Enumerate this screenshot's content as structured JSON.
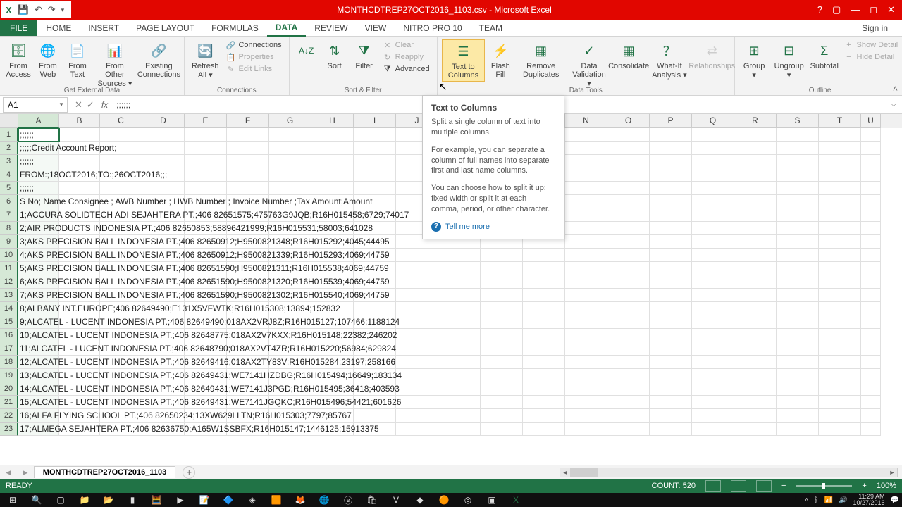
{
  "title": "MONTHCDTREP27OCT2016_1103.csv - Microsoft Excel",
  "tabs": [
    "FILE",
    "HOME",
    "INSERT",
    "PAGE LAYOUT",
    "FORMULAS",
    "DATA",
    "REVIEW",
    "VIEW",
    "NITRO PRO 10",
    "TEAM"
  ],
  "active_tab": "DATA",
  "signin": "Sign in",
  "ribbon": {
    "getdata": {
      "label": "Get External Data",
      "btns": [
        "From Access",
        "From Web",
        "From Text",
        "From Other Sources ▾",
        "Existing Connections"
      ]
    },
    "connections": {
      "label": "Connections",
      "refresh": "Refresh All ▾",
      "items": [
        "Connections",
        "Properties",
        "Edit Links"
      ]
    },
    "sortfilter": {
      "label": "Sort & Filter",
      "sort": "Sort",
      "filter": "Filter",
      "items": [
        "Clear",
        "Reapply",
        "Advanced"
      ]
    },
    "datatools": {
      "label": "Data Tools",
      "btns": [
        "Text to Columns",
        "Flash Fill",
        "Remove Duplicates",
        "Data Validation ▾",
        "Consolidate",
        "What-If Analysis ▾",
        "Relationships"
      ]
    },
    "outline": {
      "label": "Outline",
      "btns": [
        "Group ▾",
        "Ungroup ▾",
        "Subtotal"
      ],
      "items": [
        "Show Detail",
        "Hide Detail"
      ]
    }
  },
  "namebox": "A1",
  "formula": ";;;;;;",
  "tooltip": {
    "title": "Text to Columns",
    "p1": "Split a single column of text into multiple columns.",
    "p2": "For example, you can separate a column of full names into separate first and last name columns.",
    "p3": "You can choose how to split it up: fixed width or split it at each comma, period, or other character.",
    "more": "Tell me more"
  },
  "columns": [
    "A",
    "B",
    "C",
    "D",
    "E",
    "F",
    "G",
    "H",
    "I",
    "J",
    "K",
    "L",
    "M",
    "N",
    "O",
    "P",
    "Q",
    "R",
    "S",
    "T",
    "U"
  ],
  "rows": [
    {
      "n": 1,
      "t": ";;;;;;"
    },
    {
      "n": 2,
      "t": ";;;;;Credit Account Report;"
    },
    {
      "n": 3,
      "t": ";;;;;;"
    },
    {
      "n": 4,
      "t": "FROM:;18OCT2016;TO:;26OCT2016;;;"
    },
    {
      "n": 5,
      "t": ";;;;;;"
    },
    {
      "n": 6,
      "t": "S No;  Name Consignee    ;  AWB Number    ;   HWB Number       ;  Invoice Number  ;Tax Amount;Amount"
    },
    {
      "n": 7,
      "t": "1;ACCURA SOLIDTECH ADI SEJAHTERA PT.;406 82651575;475763G9JQB;R16H015458;6729;74017"
    },
    {
      "n": 8,
      "t": "2;AIR PRODUCTS INDONESIA PT.;406 82650853;58896421999;R16H015531;58003;641028"
    },
    {
      "n": 9,
      "t": "3;AKS PRECISION BALL INDONESIA PT.;406 82650912;H9500821348;R16H015292;4045;44495"
    },
    {
      "n": 10,
      "t": "4;AKS PRECISION BALL INDONESIA PT.;406 82650912;H9500821339;R16H015293;4069;44759"
    },
    {
      "n": 11,
      "t": "5;AKS PRECISION BALL INDONESIA PT.;406 82651590;H9500821311;R16H015538;4069;44759"
    },
    {
      "n": 12,
      "t": "6;AKS PRECISION BALL INDONESIA PT.;406 82651590;H9500821320;R16H015539;4069;44759"
    },
    {
      "n": 13,
      "t": "7;AKS PRECISION BALL INDONESIA PT.;406 82651590;H9500821302;R16H015540;4069;44759"
    },
    {
      "n": 14,
      "t": "8;ALBANY INT.EUROPE;406 82649490;E131X5VFWTK;R16H015308;13894;152832"
    },
    {
      "n": 15,
      "t": "9;ALCATEL - LUCENT INDONESIA PT.;406 82649490;018AX2VRJ8Z;R16H015127;107466;1188124"
    },
    {
      "n": 16,
      "t": "10;ALCATEL - LUCENT INDONESIA PT.;406 82648775;018AX2V7KXX;R16H015148;22382;246202"
    },
    {
      "n": 17,
      "t": "11;ALCATEL - LUCENT INDONESIA PT.;406 82648790;018AX2VT4ZR;R16H015220;56984;629824"
    },
    {
      "n": 18,
      "t": "12;ALCATEL - LUCENT INDONESIA PT.;406 82649416;018AX2TY83V;R16H015284;23197;258166"
    },
    {
      "n": 19,
      "t": "13;ALCATEL - LUCENT INDONESIA PT.;406 82649431;WE7141HZDBG;R16H015494;16649;183134"
    },
    {
      "n": 20,
      "t": "14;ALCATEL - LUCENT INDONESIA PT.;406 82649431;WE7141J3PGD;R16H015495;36418;403593"
    },
    {
      "n": 21,
      "t": "15;ALCATEL - LUCENT INDONESIA PT.;406 82649431;WE7141JGQKC;R16H015496;54421;601626"
    },
    {
      "n": 22,
      "t": "16;ALFA FLYING SCHOOL PT.;406 82650234;13XW629LLTN;R16H015303;7797;85767"
    },
    {
      "n": 23,
      "t": "17;ALMEGA SEJAHTERA PT.;406 82636750;A165W1SSBFX;R16H015147;1446125;15913375"
    }
  ],
  "sheet_name": "MONTHCDTREP27OCT2016_1103",
  "status": {
    "ready": "READY",
    "count": "COUNT: 520",
    "zoom": "100%"
  },
  "clock": {
    "time": "11:29 AM",
    "date": "10/27/2016"
  }
}
